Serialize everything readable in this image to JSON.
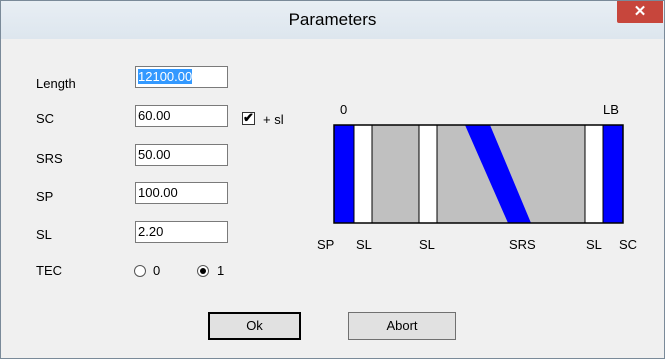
{
  "window": {
    "title": "Parameters",
    "close_glyph": "✕"
  },
  "form": {
    "length": {
      "label": "Length",
      "value": "12100.00"
    },
    "sc": {
      "label": "SC",
      "value": "60.00"
    },
    "srs": {
      "label": "SRS",
      "value": "50.00"
    },
    "sp": {
      "label": "SP",
      "value": "100.00"
    },
    "sl": {
      "label": "SL",
      "value": "2.20"
    },
    "plus_sl": {
      "label": "+ sl",
      "checked": true,
      "check_glyph": "✔"
    },
    "tec": {
      "label": "TEC",
      "options": [
        {
          "label": "0",
          "selected": false
        },
        {
          "label": "1",
          "selected": true
        }
      ]
    }
  },
  "diagram": {
    "start_label": "0",
    "end_label": "LB",
    "bottom_labels": [
      "SP",
      "SL",
      "SL",
      "SRS",
      "SL",
      "SC"
    ],
    "colors": {
      "blue": "#0000ff",
      "gray": "#c0c0c0",
      "white": "#ffffff",
      "outline": "#000000"
    }
  },
  "buttons": {
    "ok": "Ok",
    "abort": "Abort"
  }
}
